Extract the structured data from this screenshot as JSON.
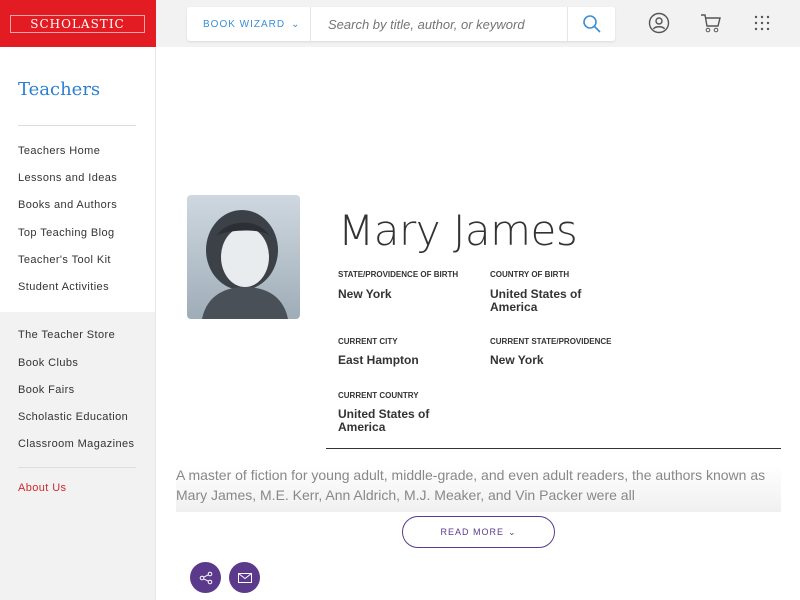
{
  "header": {
    "logo": "SCHOLASTIC",
    "book_wizard": "BOOK WIZARD",
    "search_placeholder": "Search by title, author, or keyword"
  },
  "sidebar": {
    "title": "Teachers",
    "group1": [
      "Teachers Home",
      "Lessons and Ideas",
      "Books and Authors",
      "Top Teaching Blog",
      "Teacher's Tool Kit",
      "Student Activities"
    ],
    "group2": [
      "The Teacher Store",
      "Book Clubs",
      "Book Fairs",
      "Scholastic Education",
      "Classroom Magazines"
    ],
    "about": "About Us"
  },
  "author": {
    "name": "Mary James",
    "fields": [
      {
        "label": "STATE/PROVIDENCE OF BIRTH",
        "value": "New York"
      },
      {
        "label": "COUNTRY OF BIRTH",
        "value": "United States of America"
      },
      {
        "label": "CURRENT CITY",
        "value": "East Hampton"
      },
      {
        "label": "CURRENT STATE/PROVIDENCE",
        "value": "New York"
      },
      {
        "label": "CURRENT COUNTRY",
        "value": "United States of America"
      }
    ],
    "bio": "A master of fiction for young adult, middle-grade, and even adult readers, the authors known as Mary James, M.E. Kerr, Ann Aldrich, M.J. Meaker, and Vin Packer were all",
    "read_more": "READ MORE"
  },
  "colors": {
    "brand_red": "#e31b23",
    "link_blue": "#2d7fd3",
    "purple": "#5b3a8c",
    "about_red": "#d0282e"
  }
}
